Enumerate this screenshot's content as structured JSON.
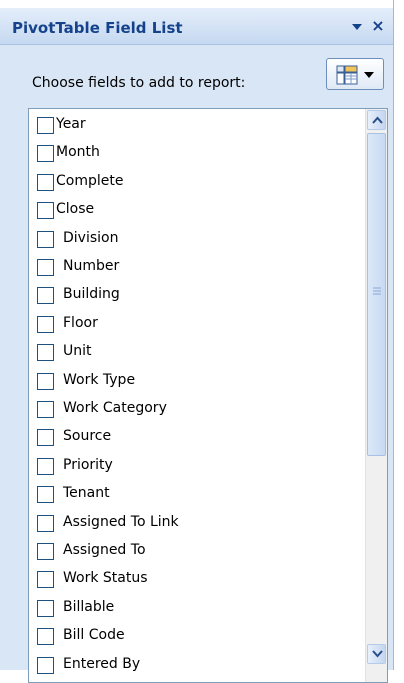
{
  "pane": {
    "title": "PivotTable Field List",
    "dropdown_icon": "triangle-down-icon",
    "close_icon": "close-icon",
    "close_glyph": "×"
  },
  "choose_label": "Choose fields to add to report:",
  "layout_button": {
    "icon": "field-layout-icon",
    "arrow_icon": "triangle-down-icon"
  },
  "fields": [
    {
      "label": "Year",
      "checked": false
    },
    {
      "label": "Month",
      "checked": false
    },
    {
      "label": "Complete",
      "checked": false
    },
    {
      "label": "Close",
      "checked": false
    },
    {
      "label": "Division",
      "checked": false
    },
    {
      "label": "Number",
      "checked": false
    },
    {
      "label": "Building",
      "checked": false
    },
    {
      "label": "Floor",
      "checked": false
    },
    {
      "label": "Unit",
      "checked": false
    },
    {
      "label": "Work Type",
      "checked": false
    },
    {
      "label": "Work Category",
      "checked": false
    },
    {
      "label": "Source",
      "checked": false
    },
    {
      "label": "Priority",
      "checked": false
    },
    {
      "label": "Tenant",
      "checked": false
    },
    {
      "label": "Assigned To Link",
      "checked": false
    },
    {
      "label": "Assigned To",
      "checked": false
    },
    {
      "label": "Work Status",
      "checked": false
    },
    {
      "label": "Billable",
      "checked": false
    },
    {
      "label": "Bill Code",
      "checked": false
    },
    {
      "label": "Entered By",
      "checked": false
    }
  ],
  "scrollbar": {
    "up_icon": "chevron-up-icon",
    "down_icon": "chevron-down-icon",
    "position_fraction": 0
  },
  "colors": {
    "title_text": "#15428b",
    "pane_background": "#d8e6f6",
    "list_border": "#7f9db9",
    "checkbox_border": "#1c5180"
  }
}
